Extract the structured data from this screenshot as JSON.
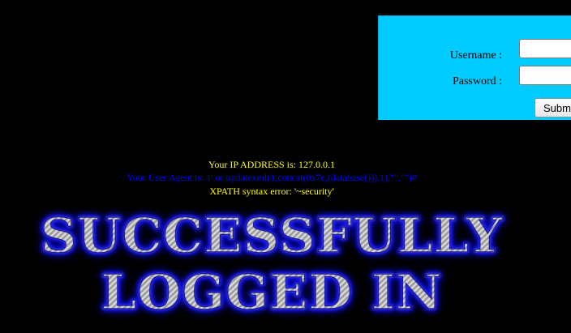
{
  "login": {
    "username_label": "Username :",
    "password_label": "Password :",
    "username_value": "",
    "password_value": "",
    "submit_label": "Submit"
  },
  "info": {
    "ip_line": "Your IP ADDRESS is: 127.0.0.1",
    "user_agent_line": "Your User Agent is: 1' or updatexml(1,concat(0x7e,(database())),1),\"\",\"\")#",
    "error_line": "XPATH syntax error: '~security'"
  },
  "banner": {
    "line1": "SUCCESSFULLY",
    "line2": "LOGGED IN"
  },
  "colors": {
    "page_background": "#000000",
    "panel_background": "#00ccff",
    "info_yellow": "#ffff00",
    "info_blue": "#0000ff",
    "banner_glow": "#2222ff"
  }
}
